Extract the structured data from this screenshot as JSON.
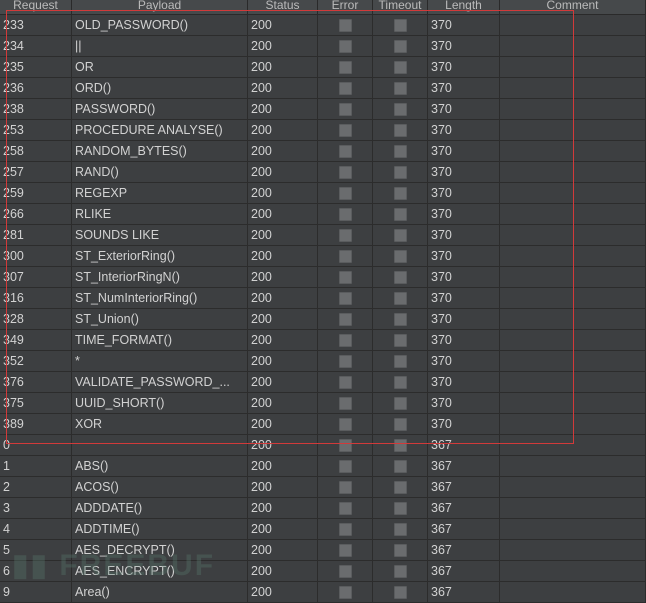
{
  "columns": [
    "Request",
    "Payload",
    "Status",
    "Error",
    "Timeout",
    "Length",
    "Comment"
  ],
  "rows": [
    [
      "233",
      "OLD_PASSWORD()",
      "200",
      "370"
    ],
    [
      "234",
      "||",
      "200",
      "370"
    ],
    [
      "235",
      "OR",
      "200",
      "370"
    ],
    [
      "236",
      "ORD()",
      "200",
      "370"
    ],
    [
      "238",
      "PASSWORD()",
      "200",
      "370"
    ],
    [
      "253",
      "PROCEDURE ANALYSE()",
      "200",
      "370"
    ],
    [
      "258",
      "RANDOM_BYTES()",
      "200",
      "370"
    ],
    [
      "257",
      "RAND()",
      "200",
      "370"
    ],
    [
      "259",
      "REGEXP",
      "200",
      "370"
    ],
    [
      "266",
      "RLIKE",
      "200",
      "370"
    ],
    [
      "281",
      "SOUNDS LIKE",
      "200",
      "370"
    ],
    [
      "300",
      "ST_ExteriorRing()",
      "200",
      "370"
    ],
    [
      "307",
      "ST_InteriorRingN()",
      "200",
      "370"
    ],
    [
      "316",
      "ST_NumInteriorRing()",
      "200",
      "370"
    ],
    [
      "328",
      "ST_Union()",
      "200",
      "370"
    ],
    [
      "349",
      "TIME_FORMAT()",
      "200",
      "370"
    ],
    [
      "352",
      "*",
      "200",
      "370"
    ],
    [
      "376",
      "VALIDATE_PASSWORD_...",
      "200",
      "370"
    ],
    [
      "375",
      "UUID_SHORT()",
      "200",
      "370"
    ],
    [
      "389",
      "XOR",
      "200",
      "370"
    ],
    [
      "0",
      "",
      "200",
      "367"
    ],
    [
      "1",
      "ABS()",
      "200",
      "367"
    ],
    [
      "2",
      "ACOS()",
      "200",
      "367"
    ],
    [
      "3",
      "ADDDATE()",
      "200",
      "367"
    ],
    [
      "4",
      "ADDTIME()",
      "200",
      "367"
    ],
    [
      "5",
      "AES_DECRYPT()",
      "200",
      "367"
    ],
    [
      "6",
      "AES_ENCRYPT()",
      "200",
      "367"
    ],
    [
      "9",
      "Area()",
      "200",
      "367"
    ]
  ],
  "watermark": "FREEBUF",
  "highlight_color": "#d23a3a"
}
